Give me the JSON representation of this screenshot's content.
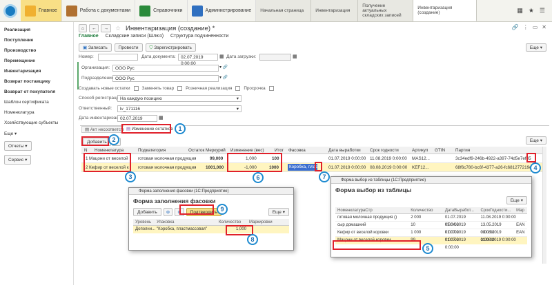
{
  "topbar": {
    "sections": [
      {
        "label": "Главное",
        "active": true
      },
      {
        "label": "Работа с документами",
        "active": false
      },
      {
        "label": "Справочники",
        "active": false
      },
      {
        "label": "Администрирование",
        "active": false
      }
    ],
    "tabs": [
      {
        "label": "Начальная страница"
      },
      {
        "label": "Инвентаризация"
      },
      {
        "label": "Получение актуальных складских записей"
      },
      {
        "label": "Инвентаризация (создание)"
      }
    ]
  },
  "sidebar": {
    "items": [
      "Реализация",
      "Поступление",
      "Производство",
      "Перемещение",
      "Инвентаризация",
      "Возврат поставщику",
      "Возврат от покупателя"
    ],
    "items_normal": [
      "Шаблон сертификата",
      "Номенклатура",
      "Хозяйствующие субъекты"
    ],
    "more": "Еще",
    "reports": "Отчеты",
    "service": "Сервис"
  },
  "doc": {
    "title": "Инвентаризация (создание) *",
    "nav_main": "Главное",
    "nav_records": "Складские записи (Шлюз)",
    "nav_struct": "Структура подчиненности",
    "btn_save": "Записать",
    "btn_post": "Провести",
    "btn_register": "Зарегистрировать",
    "more": "Еще",
    "number_label": "Номер:",
    "date_label": "Дата документа:",
    "date_value": "02.07.2019  0:00:00",
    "load_label": "Дата загрузки:",
    "org_label": "Организация:",
    "org_value": "ООО Рус",
    "dept_label": "Подразделение:",
    "dept_value": "ООО Рус",
    "create_new": "Создавать новые остатки",
    "replace": "Заменять товар",
    "retail": "Розничная реализация",
    "expired": "Просрочка",
    "reg_method_label": "Способ регистрации:",
    "reg_method_value": "На каждую позицию",
    "resp_label": "Ответственный:",
    "resp_value": "lv_171116",
    "inv_date_label": "Дата инвентаризации:",
    "inv_date_value": "02.07.2019"
  },
  "tabs": {
    "act": "Акт несоответствия",
    "change": "Изменение остатков"
  },
  "grid": {
    "add": "Добавить",
    "more": "Еще",
    "headers": [
      "N",
      "Номенклатура",
      "Подкатегория",
      "Остаток Меркурий",
      "Изменение (вес)",
      "Итог",
      "Фасовка",
      "Дата выработки",
      "Срок годности",
      "Артикул",
      "GTIN",
      "Партия"
    ],
    "rows": [
      {
        "n": "1",
        "name": "Мацони от веселой",
        "sub": "готовая молочная продукция",
        "rest": "99,000",
        "change": "1,000",
        "total": "100",
        "pack": "",
        "prod": "01.07.2019  0:00:00",
        "exp": "11.08.2019  0:00:00",
        "art": "MAS12...",
        "gtin": "",
        "batch": "3c34edf9-246b-4922-a397-74d5e7ef455"
      },
      {
        "n": "2",
        "name": "Кефир от веселой к",
        "sub": "готовая молочная продукция",
        "rest": "1001,000",
        "change": "-1,000",
        "total": "1000",
        "pack": "Коробка, пласт",
        "prod": "01.07.2019  0:00:00",
        "exp": "08.08.2019  0:00:00",
        "art": "KEF12...",
        "gtin": "",
        "batch": "68f6c780-bc6f-4377-a26-fc681277219d"
      }
    ]
  },
  "popup1": {
    "window": "Форма заполнения фасовки  (1С:Предприятие)",
    "title": "Форма заполнения фасовки",
    "add": "Добавить",
    "confirm": "Подтвердить",
    "more": "Еще",
    "headers": [
      "Уровень",
      "Упаковка",
      "Количество",
      "Маркировки"
    ],
    "row": {
      "level": "Дополни...",
      "pack": "\"Коробка, пластмассовая\"",
      "qty": "1,000"
    }
  },
  "popup2": {
    "window": "Форма выбор из таблицы  (1С:Предприятие)",
    "title": "Форма выбор из таблицы",
    "more": "Еще",
    "headers": [
      "НоменклатураСтр",
      "Количество",
      "ДатаВыработ...",
      "СрокГодности...",
      "Мар"
    ],
    "rows": [
      {
        "name": "готовая молочная продукция ()",
        "qty": "2 000",
        "prod": "01.07.2019 0:00:00",
        "exp": "11.08.2019 0:00:00",
        "mark": ""
      },
      {
        "name": "сыр домашний",
        "qty": "10",
        "prod": "05.04.2019 0:00:00",
        "exp": "13.05.2019 0:00:00",
        "mark": "EAN"
      },
      {
        "name": "Кефир от веселой коровки",
        "qty": "1 000",
        "prod": "01.07.2019 0:00:00",
        "exp": "08.08.2019 0:00:00",
        "mark": "EAN"
      },
      {
        "name": "Мацони от веселой коровки",
        "qty": "99",
        "prod": "01.07.2019 0:00:00",
        "exp": "11.08.2019 0:00:00",
        "mark": ""
      }
    ]
  },
  "markers": [
    "1",
    "2",
    "3",
    "4",
    "5",
    "6",
    "7",
    "8",
    "9"
  ],
  "colors": {
    "accent": "#f8df86",
    "marker_red": "#e0202a",
    "marker_blue": "#1d8ad0",
    "selected_row": "#fff5c0",
    "highlight_blue": "#3c6fd0"
  }
}
